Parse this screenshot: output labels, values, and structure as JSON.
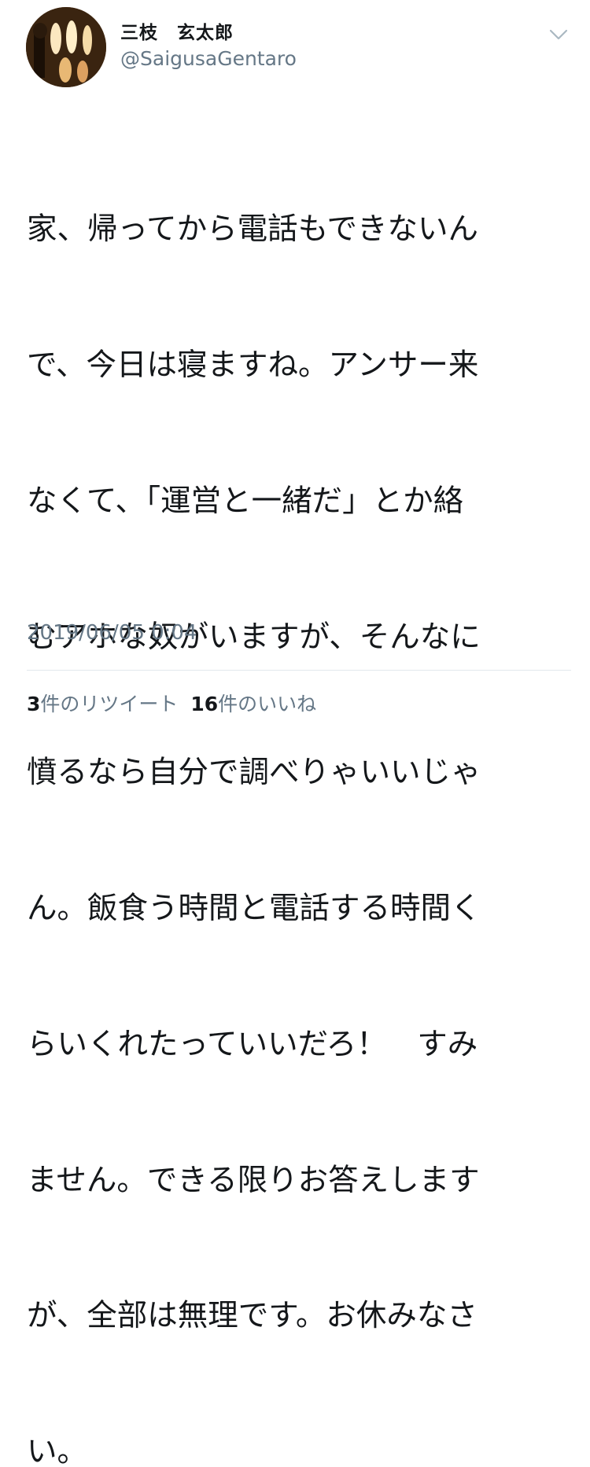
{
  "user": {
    "display_name": "三枝　玄太郎",
    "handle": "@SaigusaGentaro"
  },
  "icons": {
    "avatar": "profile-photo",
    "menu": "chevron-down-icon"
  },
  "tweet": {
    "lines": [
      "家、帰ってから電話もできないん",
      "で、今日は寝ますね。アンサー来",
      "なくて、「運営と一緒だ」とか絡",
      "むアホな奴がいますが、そんなに",
      "憤るなら自分で調べりゃいいじゃ",
      "ん。飯食う時間と電話する時間く",
      "らいくれたっていいだろ！　すみ",
      "ません。できる限りお答えします",
      "が、全部は無理です。お休みなさ",
      "い。"
    ],
    "timestamp": "2019/06/05 0:04"
  },
  "stats": {
    "retweets_count": "3",
    "retweets_label": "件のリツイート",
    "likes_count": "16",
    "likes_label": "件のいいね"
  },
  "colors": {
    "text": "#14171a",
    "secondary": "#657786",
    "divider": "#e1e8ed"
  }
}
